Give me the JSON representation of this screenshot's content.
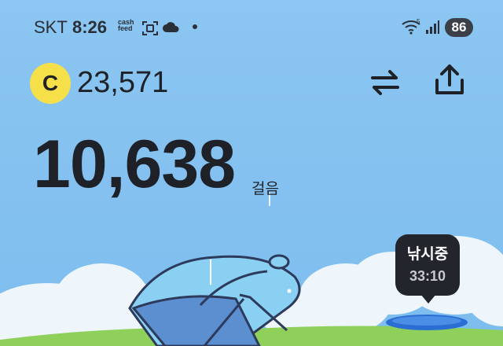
{
  "status_bar": {
    "carrier": "SKT",
    "time": "8:26",
    "app_notice": "cash feed",
    "battery": "86",
    "icons": [
      "scan-icon",
      "cloud-icon",
      "wifi-icon",
      "signal-icon"
    ]
  },
  "header": {
    "coin_symbol": "C",
    "coin_amount": "23,571",
    "icons": [
      "swap-icon",
      "share-icon"
    ]
  },
  "steps": {
    "count": "10,638",
    "unit": "걸음"
  },
  "fishing": {
    "label": "낚시중",
    "timer": "33:10"
  },
  "colors": {
    "sky": "#86c2f0",
    "coin": "#f6e04a",
    "grass": "#8fd05a",
    "badge": "#22252b",
    "umbrella": "#8ad0f2"
  }
}
